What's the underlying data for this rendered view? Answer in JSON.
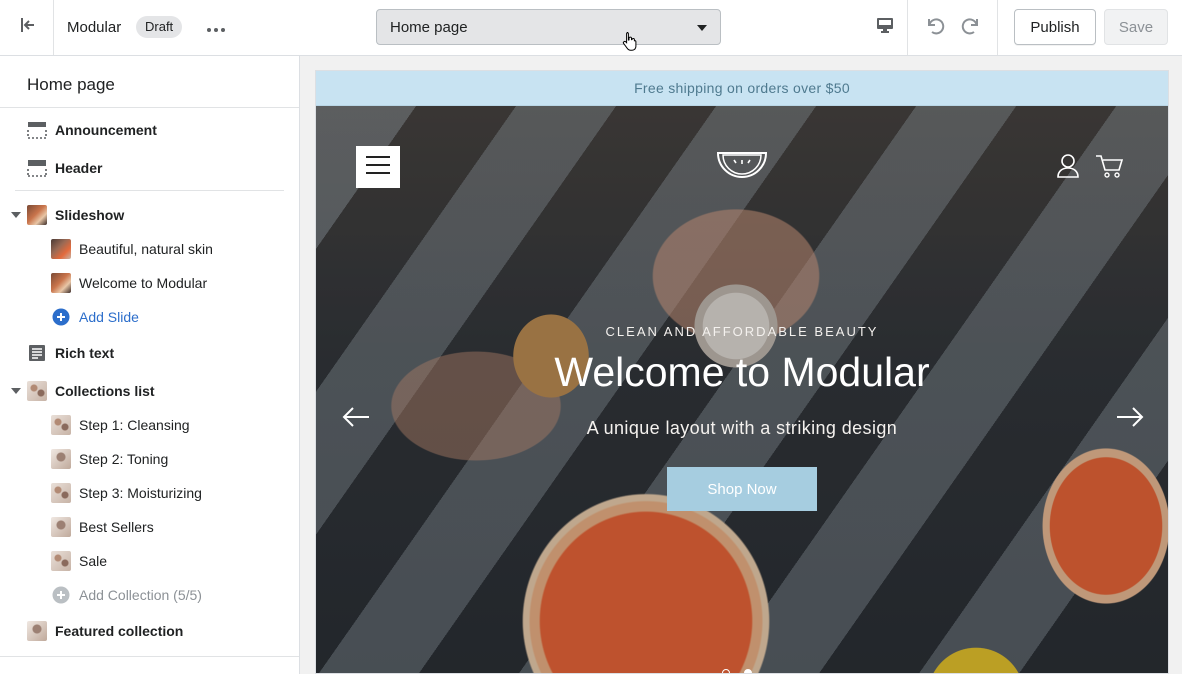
{
  "topbar": {
    "theme_name": "Modular",
    "status_badge": "Draft",
    "page_select_value": "Home page",
    "publish_label": "Publish",
    "save_label": "Save"
  },
  "sidebar": {
    "title": "Home page",
    "sections": [
      {
        "label": "Announcement",
        "icon": "announcement-bar-icon"
      },
      {
        "label": "Header",
        "icon": "header-layout-icon"
      },
      {
        "label": "Slideshow",
        "icon": "slideshow-thumbnail",
        "expanded": true
      },
      {
        "label": "Beautiful, natural skin",
        "icon": "slide-thumbnail"
      },
      {
        "label": "Welcome to Modular",
        "icon": "slide-thumbnail"
      },
      {
        "label": "Add Slide",
        "icon": "plus-circle-icon"
      },
      {
        "label": "Rich text",
        "icon": "text-block-icon"
      },
      {
        "label": "Collections list",
        "icon": "collection-thumbnail",
        "expanded": true
      },
      {
        "label": "Step 1: Cleansing",
        "icon": "collection-thumbnail"
      },
      {
        "label": "Step 2: Toning",
        "icon": "collection-thumbnail"
      },
      {
        "label": "Step 3: Moisturizing",
        "icon": "collection-thumbnail"
      },
      {
        "label": "Best Sellers",
        "icon": "collection-thumbnail"
      },
      {
        "label": "Sale",
        "icon": "collection-thumbnail"
      },
      {
        "label": "Add Collection (5/5)",
        "icon": "plus-circle-icon",
        "disabled": true
      },
      {
        "label": "Featured collection",
        "icon": "collection-thumbnail"
      }
    ]
  },
  "preview": {
    "announcement": "Free shipping on orders over $50",
    "hero": {
      "subheading": "CLEAN AND AFFORDABLE BEAUTY",
      "heading": "Welcome to Modular",
      "text": "A unique layout with a striking design",
      "button_label": "Shop Now",
      "slide_count": 2,
      "active_slide": 2
    }
  },
  "colors": {
    "announcement_bg": "#c8e3f2",
    "cta_bg": "#a6cde0",
    "link": "#2c6ecb"
  }
}
